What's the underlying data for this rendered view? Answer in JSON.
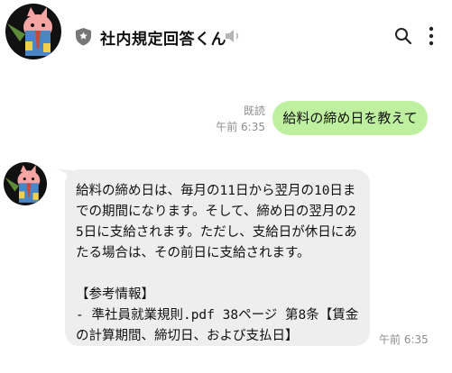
{
  "chat": {
    "title": "社内規定回答くん"
  },
  "icons": {
    "verified": "shield-icon",
    "mute": "speaker-muted-icon",
    "search": "search-icon",
    "menu": "more-vertical-icon"
  },
  "messages": {
    "sent": {
      "read_label": "既読",
      "time": "午前 6:35",
      "text": "給料の締め日を教えて"
    },
    "received": {
      "text": "給料の締め日は、毎月の11日から翌月の10日までの期間になります。そして、締め日の翌月の25日に支給されます。ただし、支給日が休日にあたる場合は、その前日に支給されます。\n\n【参考情報】\n- 準社員就業規則.pdf 38ページ 第8条【賃金の計算期間、締切日、および支払日】",
      "time": "午前 6:35"
    }
  },
  "colors": {
    "sent_bubble": "#bff0a0",
    "received_bubble": "#eeeeee",
    "meta_text": "#8d8d8d",
    "avatar_bg": "#111111",
    "cat_body": "#f6a5a5",
    "cat_shirt": "#4a86c5",
    "cat_tie": "#c64a3a",
    "leaf": "#5e8b3a"
  }
}
